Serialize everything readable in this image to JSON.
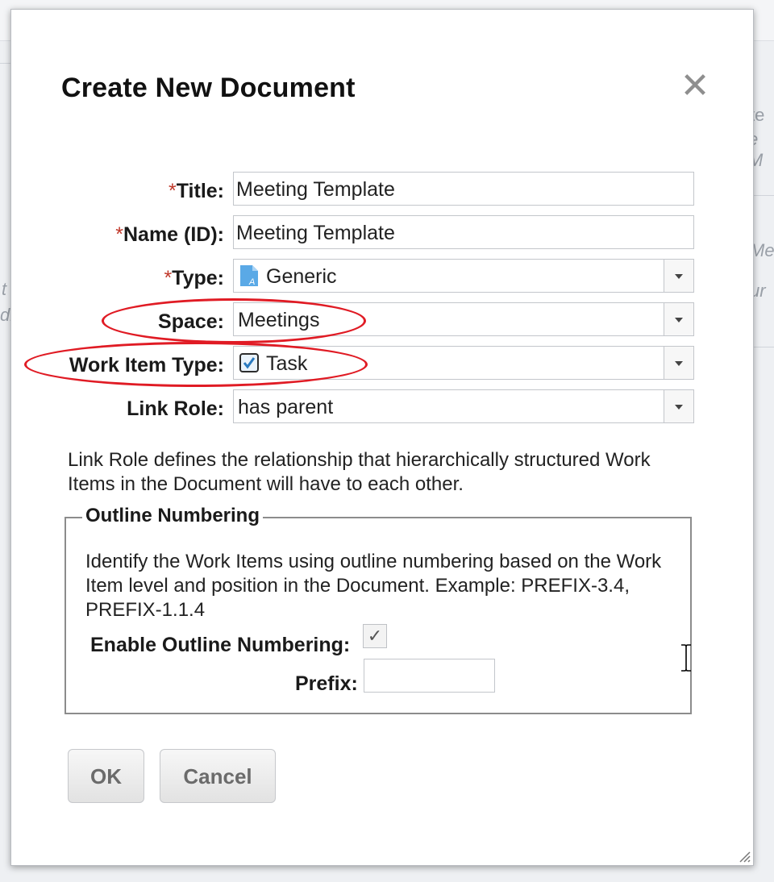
{
  "dialog": {
    "title": "Create New Document",
    "close_symbol": "✕",
    "fields": {
      "title_label": "Title:",
      "title_value": "Meeting Template",
      "name_label": "Name (ID):",
      "name_value": "Meeting Template",
      "type_label": "Type:",
      "type_value": "Generic",
      "space_label": "Space:",
      "space_value": "Meetings",
      "work_item_type_label": "Work Item Type:",
      "work_item_type_value": "Task",
      "link_role_label": "Link Role:",
      "link_role_value": "has parent",
      "required_marker": "*"
    },
    "link_role_description": "Link Role defines the relationship that hierarchically structured Work Items in the Document will have to each other.",
    "outline": {
      "legend": "Outline Numbering",
      "description": "Identify the Work Items using outline numbering based on the Work Item level and position in the Document. Example: PREFIX-3.4, PREFIX-1.1.4",
      "enable_label": "Enable Outline Numbering:",
      "enable_checked": true,
      "check_symbol": "✓",
      "prefix_label": "Prefix:",
      "prefix_value": ""
    },
    "buttons": {
      "ok": "OK",
      "cancel": "Cancel"
    },
    "icons": {
      "type_icon": "generic-document-icon",
      "work_item_icon": "task-checkbox-icon"
    },
    "annotation_color": "#e01b24"
  },
  "background_fragments": [
    "te",
    "e M",
    "Me",
    "t",
    "ur",
    "di"
  ]
}
